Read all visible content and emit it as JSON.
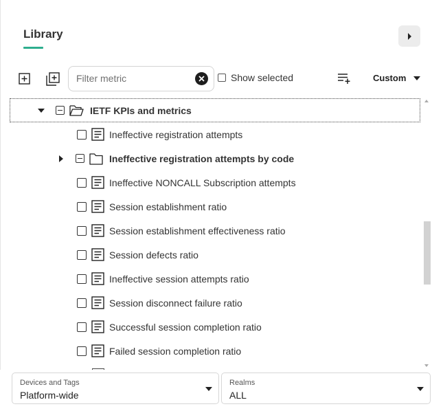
{
  "header": {
    "title": "Library"
  },
  "toolbar": {
    "filter_placeholder": "Filter metric",
    "filter_value": "",
    "show_selected_label": "Show selected",
    "view_mode": "Custom"
  },
  "tree": {
    "group": {
      "label": "IETF KPIs and metrics",
      "expanded": true,
      "selected": true
    },
    "items": [
      {
        "label": "Ineffective registration attempts",
        "type": "metric",
        "checked": false
      },
      {
        "label": "Ineffective registration attempts by code",
        "type": "folder",
        "expanded": false,
        "checked": "partial"
      },
      {
        "label": "Ineffective NONCALL Subscription attempts",
        "type": "metric",
        "checked": false
      },
      {
        "label": "Session establishment ratio",
        "type": "metric",
        "checked": false
      },
      {
        "label": "Session establishment effectiveness ratio",
        "type": "metric",
        "checked": false
      },
      {
        "label": "Session defects ratio",
        "type": "metric",
        "checked": false
      },
      {
        "label": "Ineffective session attempts ratio",
        "type": "metric",
        "checked": false
      },
      {
        "label": "Session disconnect failure ratio",
        "type": "metric",
        "checked": false
      },
      {
        "label": "Successful session completion ratio",
        "type": "metric",
        "checked": false
      },
      {
        "label": "Failed session completion ratio",
        "type": "metric",
        "checked": false
      }
    ]
  },
  "footer": {
    "devices": {
      "label": "Devices and Tags",
      "value": "Platform-wide"
    },
    "realms": {
      "label": "Realms",
      "value": "ALL"
    }
  },
  "icons": {
    "collapse": "chevron-right-icon",
    "expand_all": "add-box-icon",
    "copy_add": "library-add-icon",
    "clear": "close-circle-icon",
    "add_list": "playlist-add-icon",
    "metric": "document-icon",
    "folder": "folder-icon"
  },
  "colors": {
    "accent": "#2eae8e"
  }
}
